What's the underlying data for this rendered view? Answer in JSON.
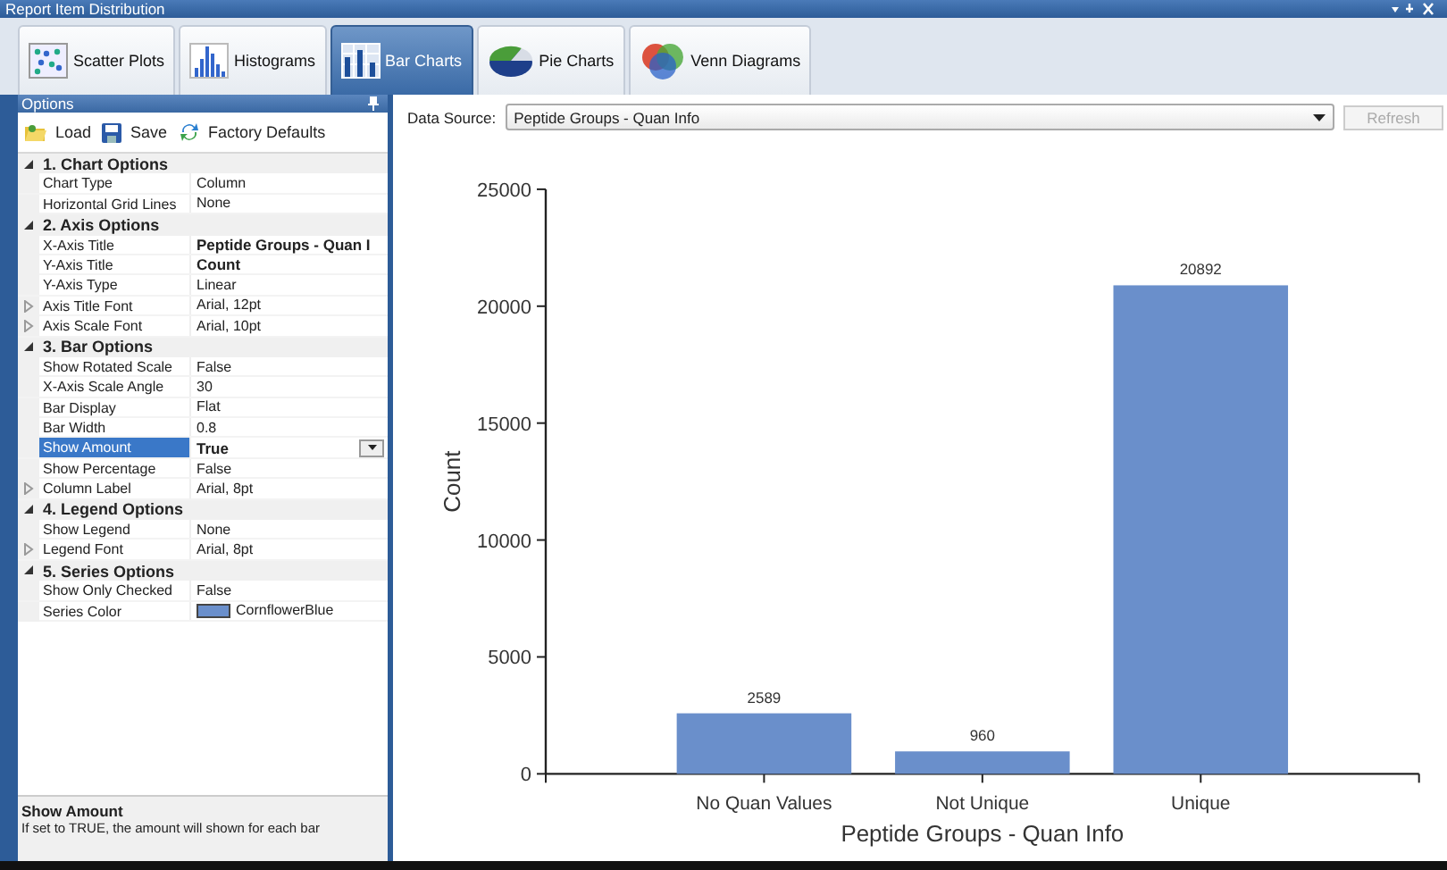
{
  "window": {
    "title": "Report Item Distribution"
  },
  "tabs": [
    {
      "label": "Scatter Plots",
      "kind": "scatter",
      "selected": false
    },
    {
      "label": "Histograms",
      "kind": "histogram",
      "selected": false
    },
    {
      "label": "Bar Charts",
      "kind": "bar",
      "selected": true
    },
    {
      "label": "Pie Charts",
      "kind": "pie",
      "selected": false
    },
    {
      "label": "Venn Diagrams",
      "kind": "venn",
      "selected": false
    }
  ],
  "options_panel": {
    "title": "Options",
    "toolbar": [
      {
        "label": "Load",
        "kind": "load"
      },
      {
        "label": "Save",
        "kind": "save"
      },
      {
        "label": "Factory Defaults",
        "kind": "reset"
      }
    ],
    "categories": [
      {
        "title": "1. Chart Options",
        "expanded": true,
        "children": [
          {
            "name": "Chart Type",
            "value": "Column",
            "modified": false,
            "expandable": false,
            "selected": false
          },
          {
            "name": "Horizontal Grid Lines",
            "value": "None",
            "modified": false,
            "expandable": false,
            "selected": false
          }
        ]
      },
      {
        "title": "2. Axis Options",
        "expanded": true,
        "children": [
          {
            "name": "X-Axis Title",
            "value": "Peptide Groups - Quan I",
            "modified": true,
            "expandable": false,
            "selected": false
          },
          {
            "name": "Y-Axis Title",
            "value": "Count",
            "modified": true,
            "expandable": false,
            "selected": false
          },
          {
            "name": "Y-Axis Type",
            "value": "Linear",
            "modified": false,
            "expandable": false,
            "selected": false
          },
          {
            "name": "Axis Title Font",
            "value": "Arial, 12pt",
            "modified": false,
            "expandable": true,
            "selected": false
          },
          {
            "name": "Axis Scale Font",
            "value": "Arial, 10pt",
            "modified": false,
            "expandable": true,
            "selected": false
          }
        ]
      },
      {
        "title": "3. Bar Options",
        "expanded": true,
        "children": [
          {
            "name": "Show Rotated Scale",
            "value": "False",
            "modified": false,
            "expandable": false,
            "selected": false
          },
          {
            "name": "X-Axis Scale Angle",
            "value": "30",
            "modified": false,
            "expandable": false,
            "selected": false
          },
          {
            "name": "Bar Display",
            "value": "Flat",
            "modified": false,
            "expandable": false,
            "selected": false
          },
          {
            "name": "Bar Width",
            "value": "0.8",
            "modified": false,
            "expandable": false,
            "selected": false
          },
          {
            "name": "Show Amount",
            "value": "True",
            "modified": true,
            "expandable": false,
            "selected": true
          },
          {
            "name": "Show Percentage",
            "value": "False",
            "modified": false,
            "expandable": false,
            "selected": false
          },
          {
            "name": "Column Label",
            "value": "Arial, 8pt",
            "modified": false,
            "expandable": true,
            "selected": false
          }
        ]
      },
      {
        "title": "4. Legend Options",
        "expanded": true,
        "children": [
          {
            "name": "Show Legend",
            "value": "None",
            "modified": false,
            "expandable": false,
            "selected": false
          },
          {
            "name": "Legend Font",
            "value": "Arial, 8pt",
            "modified": false,
            "expandable": true,
            "selected": false
          }
        ]
      },
      {
        "title": "5. Series Options",
        "expanded": true,
        "children": [
          {
            "name": "Show Only Checked",
            "value": "False",
            "modified": false,
            "expandable": false,
            "selected": false
          },
          {
            "name": "Series Color",
            "value": "CornflowerBlue",
            "modified": false,
            "expandable": false,
            "selected": false,
            "color": "#6a8fcb"
          }
        ]
      }
    ],
    "description": {
      "title": "Show Amount",
      "text": "If set to TRUE, the amount will shown for each bar"
    }
  },
  "data_source": {
    "label": "Data Source:",
    "value": "Peptide Groups - Quan Info",
    "refresh_button": "Refresh",
    "refresh_disabled": true
  },
  "chart": {
    "chart_data": {
      "type": "bar",
      "xlabel": "Peptide Groups - Quan Info",
      "ylabel": "Count",
      "categories": [
        "No Quan Values",
        "Not Unique",
        "Unique"
      ],
      "values": [
        2589,
        960,
        20892
      ],
      "ylim": [
        0,
        25000
      ],
      "yticks": [
        0,
        5000,
        10000,
        15000,
        20000,
        25000
      ],
      "data_labels": true
    }
  }
}
